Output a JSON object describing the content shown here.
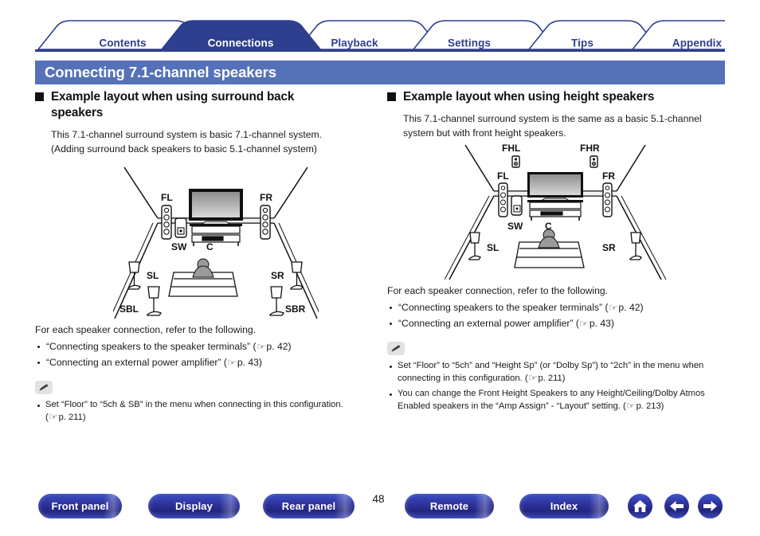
{
  "tabs": [
    {
      "label": "Contents",
      "active": false
    },
    {
      "label": "Connections",
      "active": true
    },
    {
      "label": "Playback",
      "active": false
    },
    {
      "label": "Settings",
      "active": false
    },
    {
      "label": "Tips",
      "active": false
    },
    {
      "label": "Appendix",
      "active": false
    }
  ],
  "title": "Connecting 7.1-channel speakers",
  "left": {
    "heading": "Example layout when using surround back speakers",
    "intro_line1": "This 7.1-channel surround system is basic 7.1-channel system.",
    "intro_line2": "(Adding surround back speakers to basic 5.1-channel system)",
    "lead": "For each speaker connection, refer to the following.",
    "bullets": [
      {
        "text": "“Connecting speakers to the speaker terminals” (",
        "page": "p. 42",
        "tail": ")"
      },
      {
        "text": "“Connecting an external power amplifier” (",
        "page": "p. 43",
        "tail": ")"
      }
    ],
    "notes": [
      {
        "text": "Set “Floor” to “5ch & SB” in the menu when connecting in this configuration.",
        "ref_open": "(",
        "page": "p. 211",
        "tail": ")"
      }
    ],
    "diagram_labels": {
      "fl": "FL",
      "fr": "FR",
      "sw": "SW",
      "c": "C",
      "sl": "SL",
      "sr": "SR",
      "sbl": "SBL",
      "sbr": "SBR"
    }
  },
  "right": {
    "heading": "Example layout when using height speakers",
    "intro_line1": "This 7.1-channel surround system is the same as a basic 5.1-channel",
    "intro_line2": "system but with front height speakers.",
    "lead": "For each speaker connection, refer to the following.",
    "bullets": [
      {
        "text": "“Connecting speakers to the speaker terminals” (",
        "page": "p. 42",
        "tail": ")"
      },
      {
        "text": "“Connecting an external power amplifier” (",
        "page": "p. 43",
        "tail": ")"
      }
    ],
    "notes": [
      {
        "text": "Set “Floor” to “5ch” and “Height Sp” (or “Dolby Sp”) to “2ch” in the menu when connecting in this configuration.",
        "ref_open": "(",
        "page": "p. 211",
        "tail": ")"
      },
      {
        "text": "You can change the Front Height Speakers to any Height/Ceiling/Dolby Atmos Enabled speakers in the “Amp Assign” - “Layout” setting.",
        "ref_open": "(",
        "page": "p. 213",
        "tail": ")"
      }
    ],
    "diagram_labels": {
      "fhl": "FHL",
      "fhr": "FHR",
      "fl": "FL",
      "fr": "FR",
      "sw": "SW",
      "c": "C",
      "sl": "SL",
      "sr": "SR"
    }
  },
  "footer": {
    "buttons": [
      {
        "label": "Front panel"
      },
      {
        "label": "Display"
      },
      {
        "label": "Rear panel"
      },
      {
        "label": "Remote"
      },
      {
        "label": "Index"
      }
    ],
    "page_number": "48",
    "icons": [
      "home-icon",
      "arrow-left-icon",
      "arrow-right-icon"
    ]
  },
  "colors": {
    "tab_blue": "#2e3f8f",
    "banner_blue": "#5571b8",
    "button_blue": "#2b2f96"
  }
}
